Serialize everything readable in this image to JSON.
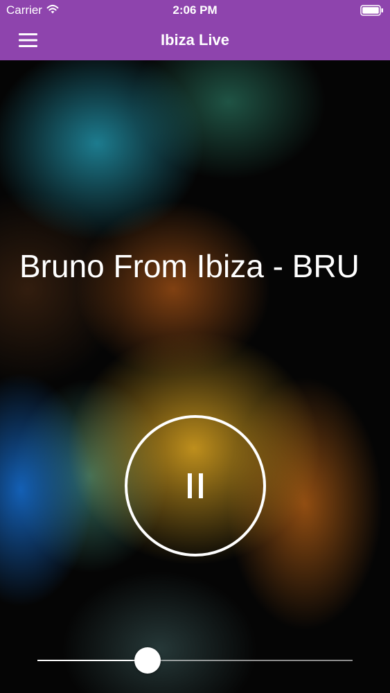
{
  "status_bar": {
    "carrier": "Carrier",
    "time": "2:06 PM",
    "wifi_icon": "wifi-icon",
    "battery_icon": "battery-icon"
  },
  "nav_bar": {
    "title": "Ibiza Live",
    "menu_icon": "hamburger-menu-icon",
    "background_color": "#8e44ad"
  },
  "player": {
    "track_title": "Bruno From Ibiza - BRU",
    "state": "playing",
    "control_icon": "pause-icon",
    "volume_fraction": 0.35
  }
}
